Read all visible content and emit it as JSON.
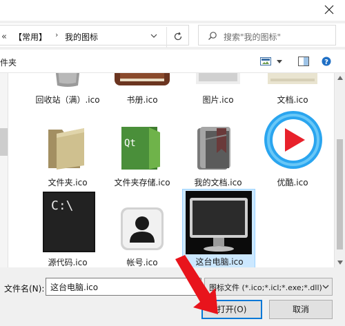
{
  "address": {
    "nav_chevron": "«",
    "path": [
      "【常用】",
      "我的图标"
    ],
    "separator": "›"
  },
  "search": {
    "placeholder": "搜索\"我的图标\""
  },
  "toolbar": {
    "left_label": "件夹"
  },
  "files": [
    {
      "name": "回收站（满）.ico",
      "icon": "recycle-bin-icon"
    },
    {
      "name": "书册.ico",
      "icon": "book-icon"
    },
    {
      "name": "图片.ico",
      "icon": "picture-icon"
    },
    {
      "name": "文档.ico",
      "icon": "document-icon"
    },
    {
      "name": "文件夹.ico",
      "icon": "folder-icon"
    },
    {
      "name": "文件夹存储.ico",
      "icon": "qt-folder-icon"
    },
    {
      "name": "我的文档.ico",
      "icon": "my-documents-icon"
    },
    {
      "name": "优酷.ico",
      "icon": "youku-icon"
    },
    {
      "name": "源代码.ico",
      "icon": "terminal-icon"
    },
    {
      "name": "帐号.ico",
      "icon": "account-icon"
    },
    {
      "name": "这台电脑.ico",
      "icon": "monitor-icon",
      "selected": true
    }
  ],
  "qt_text": "Qt",
  "terminal_text": "C:\\",
  "bottom": {
    "filename_label": "文件名(N):",
    "filename_value": "这台电脑.ico",
    "filter_value": "图标文件 (*.ico;*.icl;*.exe;*.dll)",
    "open_label": "打开(O)",
    "cancel_label": "取消"
  },
  "colors": {
    "accent": "#0078d7",
    "selection": "#cce8ff",
    "arrow": "#e8141c"
  }
}
